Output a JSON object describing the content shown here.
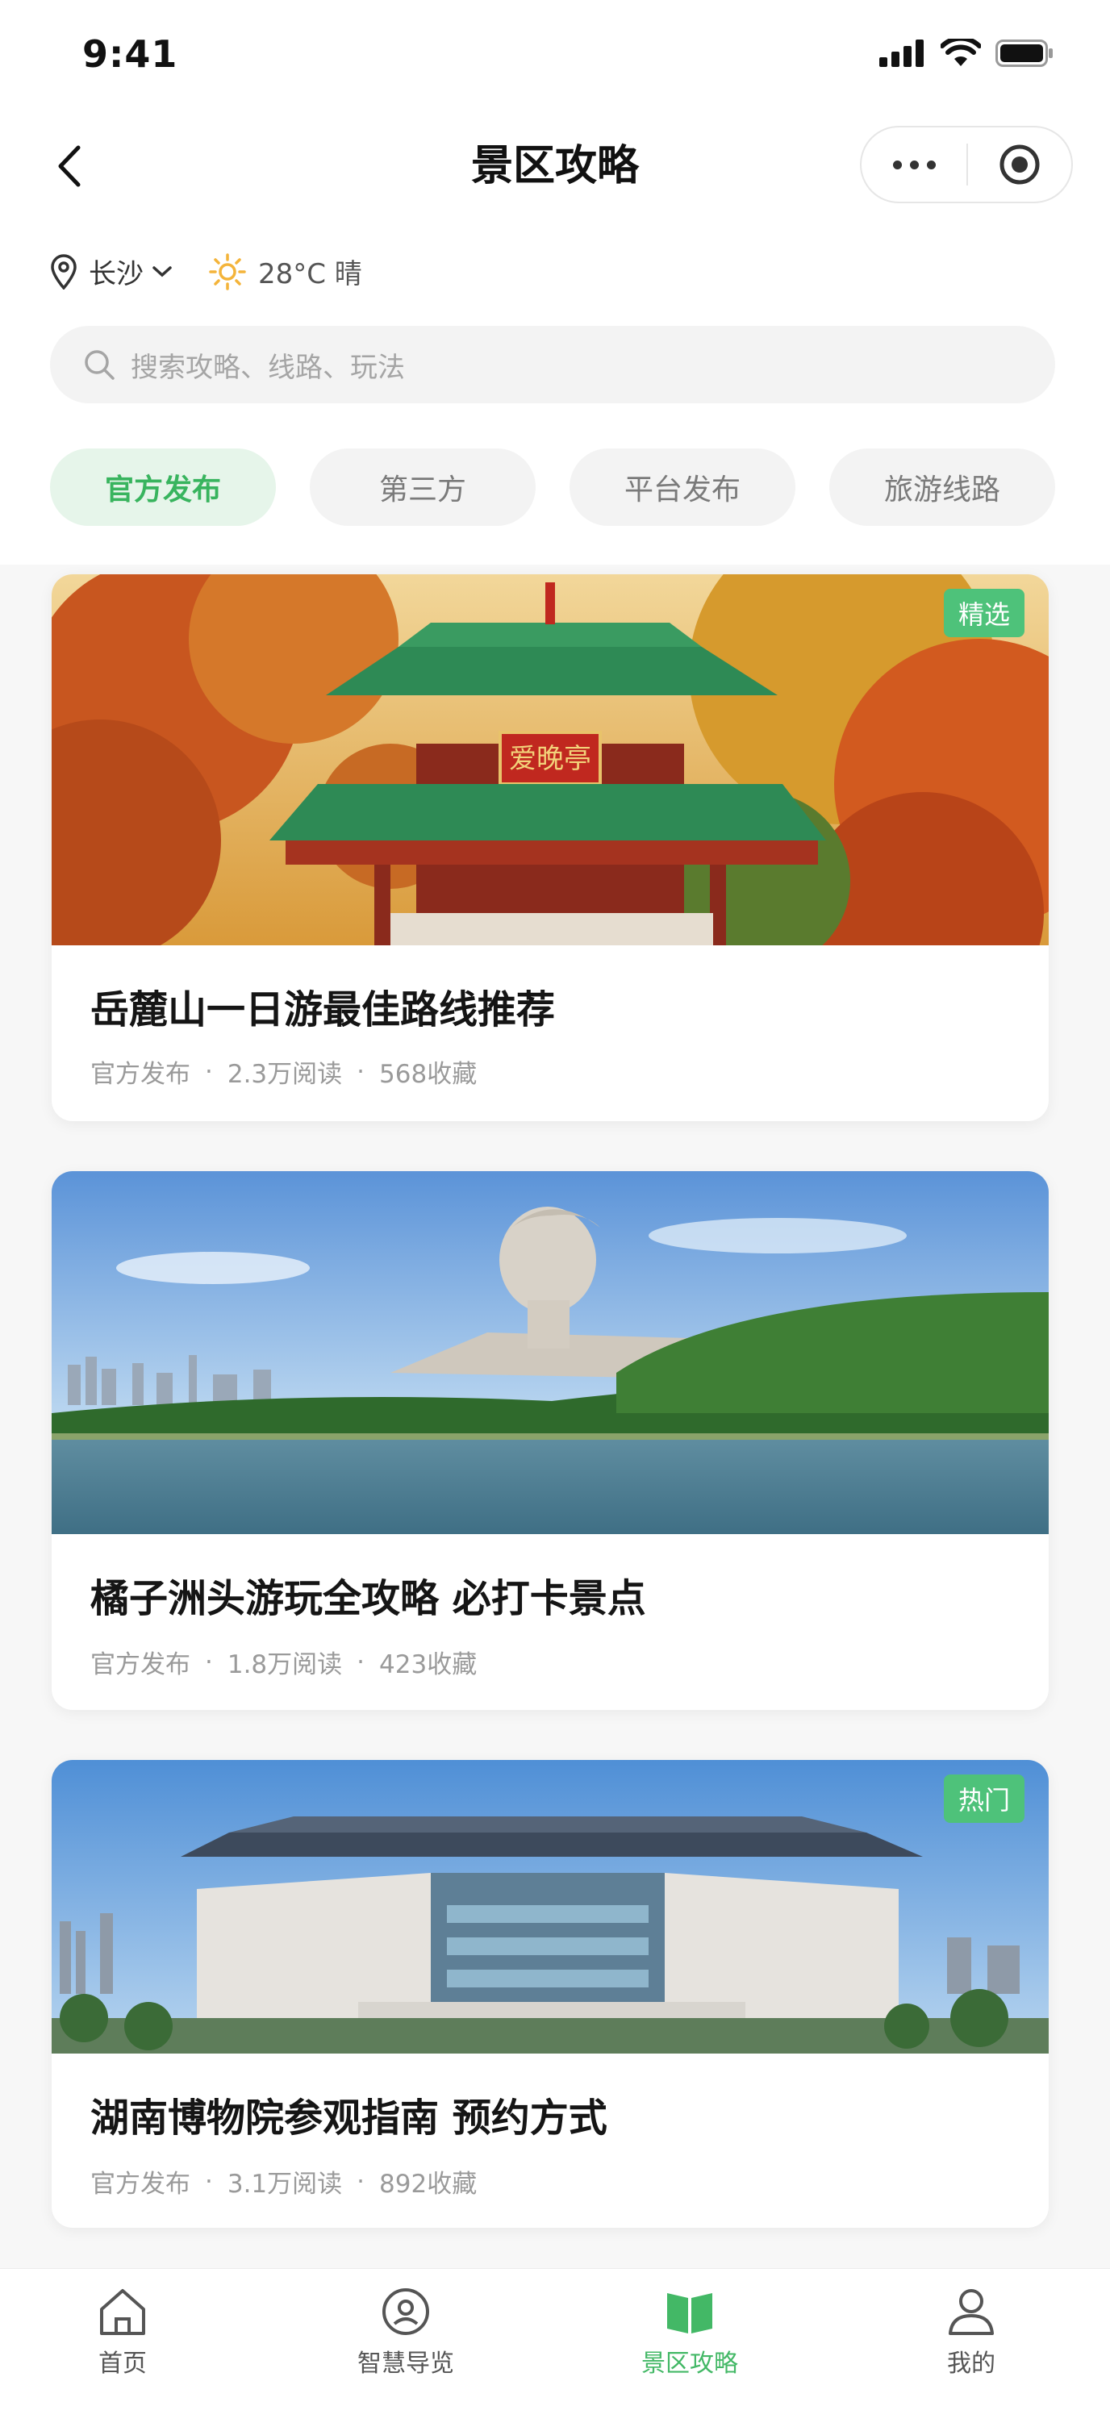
{
  "status": {
    "time": "9:41"
  },
  "nav": {
    "title": "景区攻略"
  },
  "location": {
    "city": "长沙",
    "weather": "28°C 晴"
  },
  "search": {
    "placeholder": "搜索攻略、线路、玩法"
  },
  "tabs": [
    {
      "label": "官方发布",
      "active": true
    },
    {
      "label": "第三方",
      "active": false
    },
    {
      "label": "平台发布",
      "active": false
    },
    {
      "label": "旅游线路",
      "active": false
    }
  ],
  "cards": [
    {
      "title": "岳麓山一日游最佳路线推荐",
      "source": "官方发布",
      "reads": "2.3万阅读",
      "favorites": "568收藏",
      "badge": "精选",
      "sign": "爱晚亭"
    },
    {
      "title": "橘子洲头游玩全攻略 必打卡景点",
      "source": "官方发布",
      "reads": "1.8万阅读",
      "favorites": "423收藏",
      "badge": ""
    },
    {
      "title": "湖南博物院参观指南 预约方式",
      "source": "官方发布",
      "reads": "3.1万阅读",
      "favorites": "892收藏",
      "badge": "热门"
    }
  ],
  "meta_separator": "·",
  "tabbar": [
    {
      "label": "首页",
      "icon": "home-icon",
      "active": false
    },
    {
      "label": "智慧导览",
      "icon": "guide-icon",
      "active": false
    },
    {
      "label": "景区攻略",
      "icon": "book-icon",
      "active": true
    },
    {
      "label": "我的",
      "icon": "user-icon",
      "active": false
    }
  ],
  "colors": {
    "accent": "#43b866",
    "badge": "#4ec27a",
    "tab_active_bg": "#e6f5ea"
  }
}
